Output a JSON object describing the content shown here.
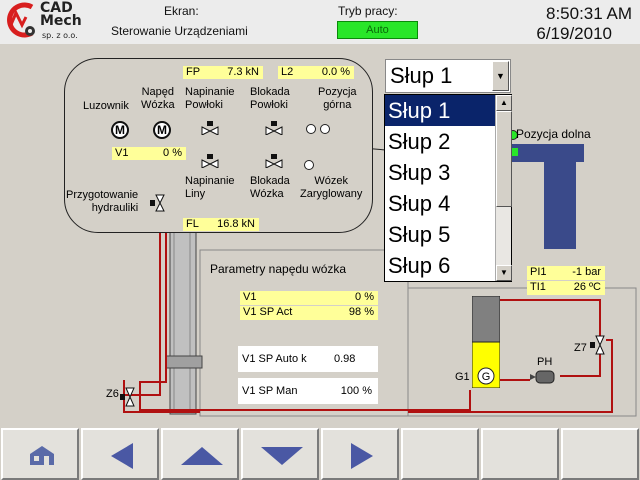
{
  "header": {
    "logo": {
      "line1": "CAD",
      "line2": "Mech",
      "line3": "sp. z o.o."
    },
    "screen_label": "Ekran:",
    "screen_value": "Sterowanie Urządzeniami",
    "mode_label": "Tryb pracy:",
    "mode_value": "Auto",
    "time": "8:50:31 AM",
    "date": "6/19/2010"
  },
  "bubble": {
    "fp_label": "FP",
    "fp_value": "7.3 kN",
    "l2_label": "L2",
    "l2_value": "0.0 %",
    "fl_label": "FL",
    "fl_value": "16.8 kN",
    "v1_label": "V1",
    "v1_value": "0 %",
    "luzownik": "Luzownik",
    "naped_wozka_1": "Napęd",
    "naped_wozka_2": "Wózka",
    "napinanie_powloki_1": "Napinanie",
    "napinanie_powloki_2": "Powłoki",
    "blokada_powloki_1": "Blokada",
    "blokada_powloki_2": "Powłoki",
    "pozycja_gorna_1": "Pozycja",
    "pozycja_gorna_2": "górna",
    "napinanie_liny_1": "Napinanie",
    "napinanie_liny_2": "Liny",
    "blokada_wozka_1": "Blokada",
    "blokada_wozka_2": "Wózka",
    "wozek_1": "Wózek",
    "wozek_2": "Zaryglowany",
    "przygotowanie_1": "Przygotowanie",
    "przygotowanie_2": "hydrauliki"
  },
  "dropdown": {
    "selected": "Słup 1",
    "options": [
      "Słup 1",
      "Słup 2",
      "Słup 3",
      "Słup 4",
      "Słup 5",
      "Słup 6"
    ]
  },
  "pozycja_dolna": "Pozycja dolna",
  "params": {
    "title": "Parametry napędu wózka",
    "v1_label": "V1",
    "v1_value": "0 %",
    "v1_sp_act_label": "V1 SP Act",
    "v1_sp_act_value": "98 %",
    "v1_sp_auto_label": "V1 SP Auto k",
    "v1_sp_auto_value": "0.98",
    "v1_sp_man_label": "V1 SP Man",
    "v1_sp_man_value": "100 %"
  },
  "hydraulics": {
    "pi1_label": "PI1",
    "pi1_value": "-1 bar",
    "ti1_label": "TI1",
    "ti1_value": "26 ºC",
    "z7": "Z7",
    "z6": "Z6",
    "g1": "G1",
    "ph": "PH"
  },
  "colors": {
    "pipe": "#b01010",
    "mode_on": "#29e629",
    "highlight": "#ffff99",
    "select": "#0a246a"
  },
  "footer": {
    "buttons": [
      "home-icon",
      "arrow-left-icon",
      "arrow-up-icon",
      "arrow-down-icon",
      "arrow-right-icon",
      "",
      "",
      ""
    ]
  }
}
